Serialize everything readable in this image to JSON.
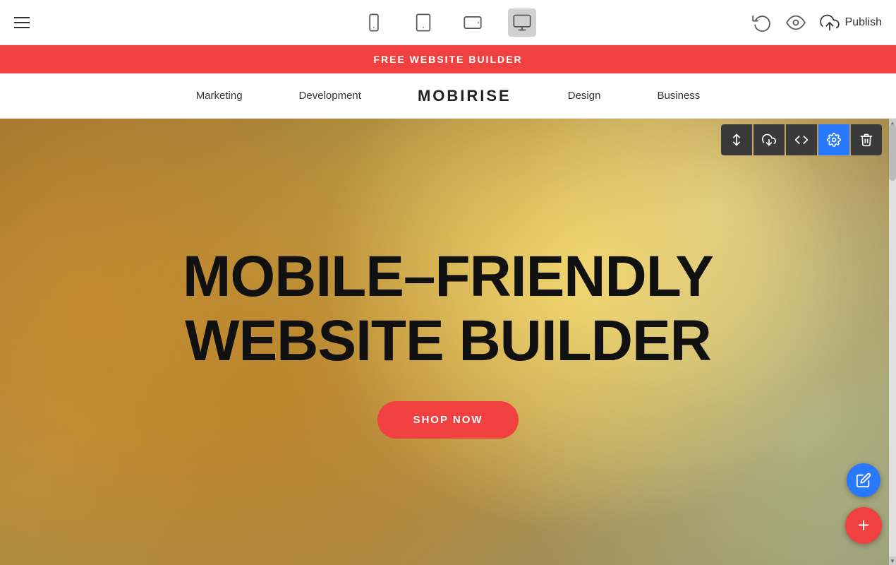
{
  "toolbar": {
    "hamburger_label": "menu",
    "devices": [
      {
        "id": "mobile",
        "label": "Mobile view",
        "active": false
      },
      {
        "id": "tablet",
        "label": "Tablet view",
        "active": false
      },
      {
        "id": "tablet-landscape",
        "label": "Tablet landscape view",
        "active": false
      },
      {
        "id": "desktop",
        "label": "Desktop view",
        "active": true
      }
    ],
    "undo_label": "Undo",
    "preview_label": "Preview",
    "publish_label": "Publish",
    "publish_icon": "upload-cloud"
  },
  "banner": {
    "text": "FREE WEBSITE BUILDER"
  },
  "nav": {
    "items": [
      {
        "label": "Marketing"
      },
      {
        "label": "Development"
      },
      {
        "label": "Design"
      },
      {
        "label": "Business"
      }
    ],
    "logo": "MOBIRISE"
  },
  "hero": {
    "title_line1": "MOBILE–FRIENDLY",
    "title_line2": "WEBSITE BUILDER",
    "cta_label": "SHOP NOW"
  },
  "block_toolbar": {
    "buttons": [
      {
        "id": "move",
        "icon": "↕",
        "label": "Move block",
        "active": false
      },
      {
        "id": "save",
        "icon": "↓",
        "label": "Save block",
        "active": false
      },
      {
        "id": "code",
        "icon": "</>",
        "label": "Edit code",
        "active": false
      },
      {
        "id": "settings",
        "icon": "⚙",
        "label": "Block settings",
        "active": true
      },
      {
        "id": "delete",
        "icon": "🗑",
        "label": "Delete block",
        "active": false
      }
    ]
  },
  "fab": {
    "pencil_label": "Edit",
    "plus_label": "Add block"
  }
}
